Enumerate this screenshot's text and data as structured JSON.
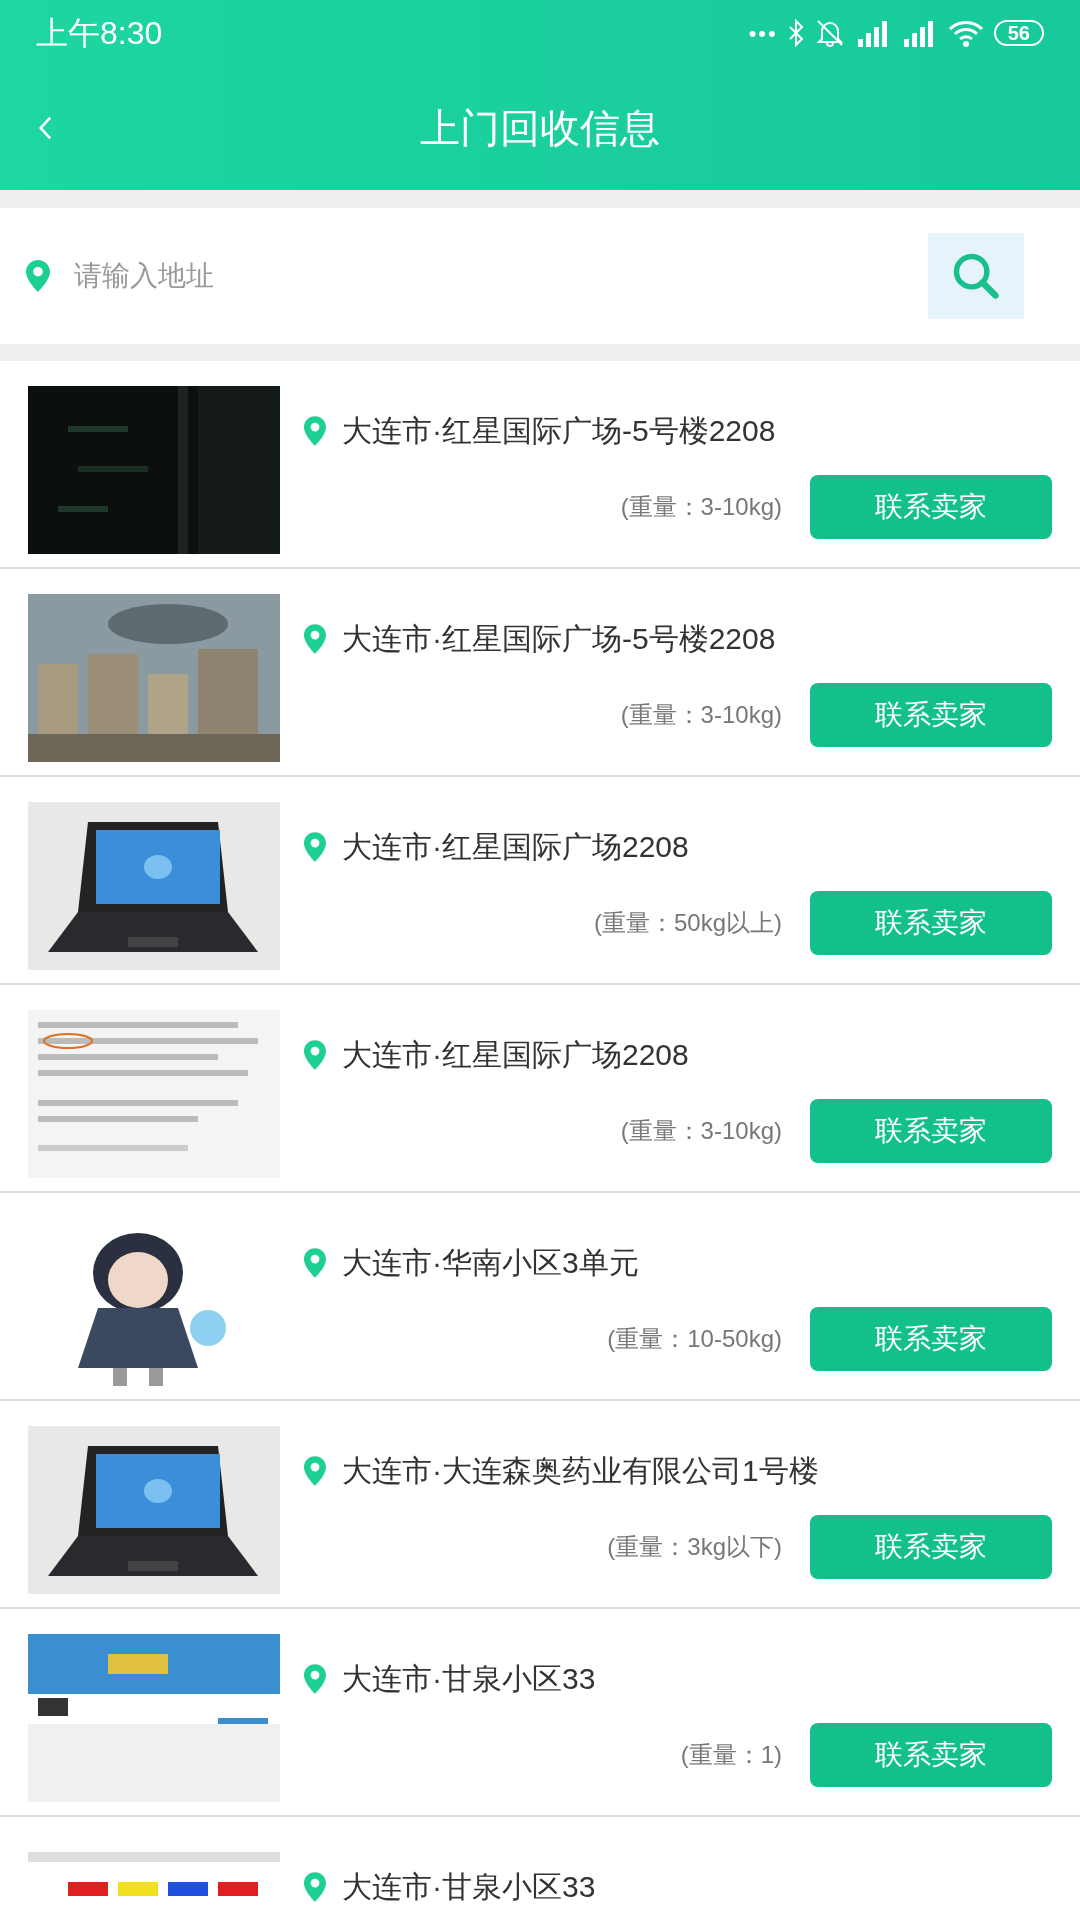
{
  "status_bar": {
    "time": "上午8:30",
    "dots": "•••",
    "battery": "56"
  },
  "header": {
    "title": "上门回收信息"
  },
  "search": {
    "placeholder": "请输入地址"
  },
  "listings": [
    {
      "address": "大连市·红星国际广场-5号楼2208",
      "weight": "(重量：3-10kg)",
      "button": "联系卖家"
    },
    {
      "address": "大连市·红星国际广场-5号楼2208",
      "weight": "(重量：3-10kg)",
      "button": "联系卖家"
    },
    {
      "address": "大连市·红星国际广场2208",
      "weight": "(重量：50kg以上)",
      "button": "联系卖家"
    },
    {
      "address": "大连市·红星国际广场2208",
      "weight": "(重量：3-10kg)",
      "button": "联系卖家"
    },
    {
      "address": "大连市·华南小区3单元",
      "weight": "(重量：10-50kg)",
      "button": "联系卖家"
    },
    {
      "address": "大连市·大连森奥药业有限公司1号楼",
      "weight": "(重量：3kg以下)",
      "button": "联系卖家"
    },
    {
      "address": "大连市·甘泉小区33",
      "weight": "(重量：1)",
      "button": "联系卖家"
    },
    {
      "address": "大连市·甘泉小区33"
    }
  ]
}
